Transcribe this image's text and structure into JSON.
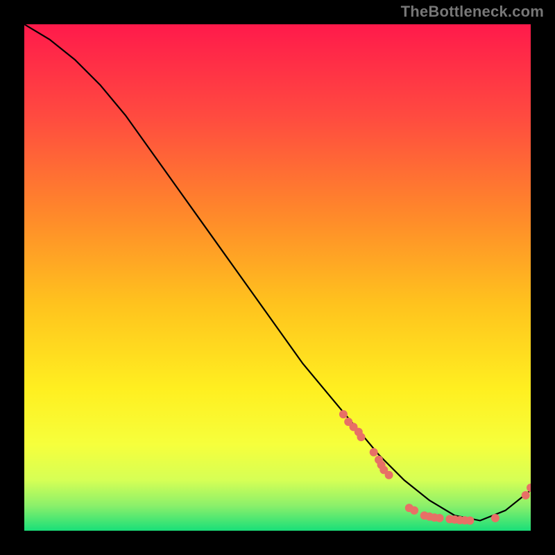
{
  "watermark": "TheBottleneck.com",
  "chart_data": {
    "type": "line",
    "title": "",
    "xlabel": "",
    "ylabel": "",
    "xlim": [
      0,
      100
    ],
    "ylim": [
      0,
      100
    ],
    "grid": false,
    "legend": false,
    "background_gradient": {
      "top_color": "#ff1a4b",
      "mid_colors": [
        "#ff6a3a",
        "#ffd21f",
        "#ffff2a",
        "#e4ff67"
      ],
      "bottom_color": "#1de07a"
    },
    "series": [
      {
        "name": "curve",
        "color": "#000000",
        "x": [
          0,
          5,
          10,
          15,
          20,
          25,
          30,
          35,
          40,
          45,
          50,
          55,
          60,
          65,
          70,
          75,
          80,
          85,
          90,
          95,
          100
        ],
        "y": [
          100,
          97,
          93,
          88,
          82,
          75,
          68,
          61,
          54,
          47,
          40,
          33,
          27,
          21,
          15,
          10,
          6,
          3,
          2,
          4,
          8
        ]
      }
    ],
    "markers": {
      "color": "#e77066",
      "radius": 6,
      "points": [
        {
          "x": 63,
          "y": 23
        },
        {
          "x": 64,
          "y": 21.5
        },
        {
          "x": 65,
          "y": 20.5
        },
        {
          "x": 66,
          "y": 19.5
        },
        {
          "x": 66.5,
          "y": 18.5
        },
        {
          "x": 69,
          "y": 15.5
        },
        {
          "x": 70,
          "y": 14
        },
        {
          "x": 70.5,
          "y": 13
        },
        {
          "x": 71,
          "y": 12
        },
        {
          "x": 72,
          "y": 11
        },
        {
          "x": 76,
          "y": 4.5
        },
        {
          "x": 77,
          "y": 4
        },
        {
          "x": 79,
          "y": 3
        },
        {
          "x": 80,
          "y": 2.8
        },
        {
          "x": 81,
          "y": 2.6
        },
        {
          "x": 82,
          "y": 2.5
        },
        {
          "x": 84,
          "y": 2.3
        },
        {
          "x": 85,
          "y": 2.2
        },
        {
          "x": 86,
          "y": 2.1
        },
        {
          "x": 87,
          "y": 2.05
        },
        {
          "x": 88,
          "y": 2
        },
        {
          "x": 93,
          "y": 2.5
        },
        {
          "x": 99,
          "y": 7
        },
        {
          "x": 100,
          "y": 8.5
        }
      ]
    }
  }
}
